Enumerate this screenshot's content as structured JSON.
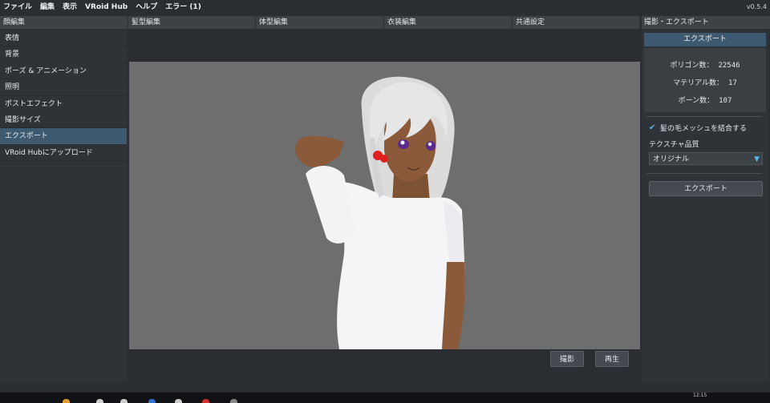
{
  "menu": {
    "items": [
      "ファイル",
      "編集",
      "表示",
      "VRoid Hub",
      "ヘルプ",
      "エラー (1)"
    ],
    "version": "v0.5.4"
  },
  "tabs": [
    "顔編集",
    "髪型編集",
    "体型編集",
    "衣装編集",
    "共通設定"
  ],
  "right_title": "撮影・エクスポート",
  "sidebar": {
    "items": [
      {
        "label": "表情",
        "active": false
      },
      {
        "label": "背景",
        "active": false
      },
      {
        "label": "ポーズ & アニメーション",
        "active": false
      },
      {
        "label": "照明",
        "active": false
      },
      {
        "label": "ポストエフェクト",
        "active": false
      },
      {
        "label": "撮影サイズ",
        "active": false
      },
      {
        "label": "エクスポート",
        "active": true
      },
      {
        "label": "VRoid Hubにアップロード",
        "active": false
      }
    ]
  },
  "viewport": {
    "buttons": {
      "shoot": "撮影",
      "play": "再生"
    }
  },
  "export_panel": {
    "header": "エクスポート",
    "stats": {
      "polygons_label": "ポリゴン数：",
      "polygons": "22546",
      "materials_label": "マテリアル数：",
      "materials": "17",
      "bones_label": "ボーン数：",
      "bones": "107"
    },
    "merge_hair_label": "髪の毛メッシュを結合する",
    "merge_hair_checked": true,
    "texture_quality_label": "テクスチャ品質",
    "texture_quality_value": "オリジナル",
    "export_button": "エクスポート"
  },
  "colors": {
    "accent": "#3e5a70",
    "check": "#59b3e6",
    "viewport_bg": "#6e6e6e"
  },
  "taskbar": {
    "time": "12:15"
  }
}
